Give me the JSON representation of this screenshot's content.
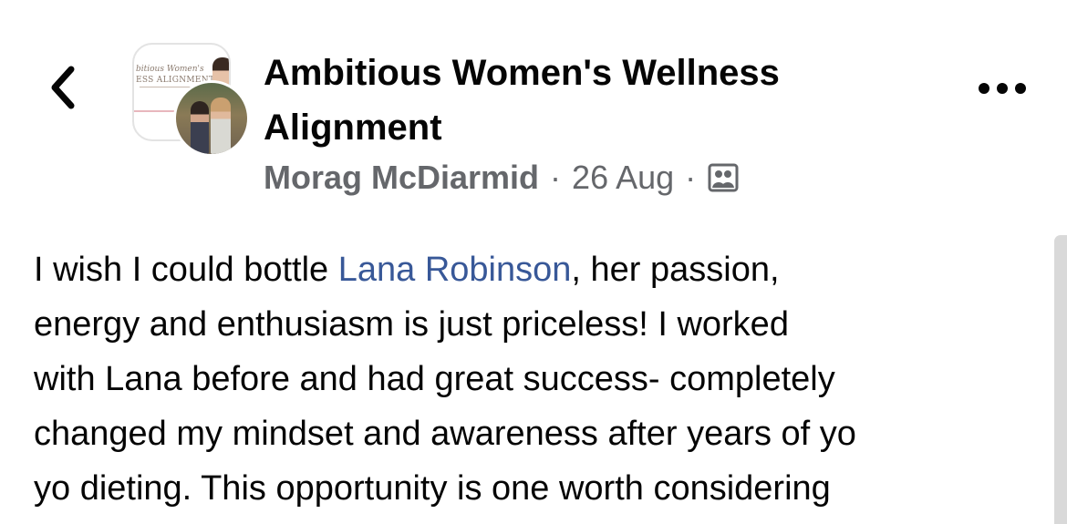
{
  "header": {
    "back_icon": "chevron-left-icon",
    "group_name": "Ambitious Women's Wellness Alignment",
    "author": "Morag McDiarmid",
    "separator": "·",
    "date": "26 Aug",
    "audience_icon": "group-members-icon",
    "more_icon": "ellipsis-icon"
  },
  "avatar": {
    "logo_line1": "bitious Women's",
    "logo_line2": "ESS ALIGNMENT"
  },
  "post": {
    "line1_pre": "I wish I could bottle ",
    "mention": "Lana Robinson",
    "line1_post": ", her passion,",
    "line2": "energy and enthusiasm is just priceless! I worked",
    "line3": "with Lana before and had great success- completely",
    "line4": "changed my mindset and awareness after years of yo",
    "line5": "yo dieting. This opportunity is one worth considering"
  },
  "colors": {
    "text": "#050505",
    "secondary_text": "#65676b",
    "link": "#385898"
  }
}
